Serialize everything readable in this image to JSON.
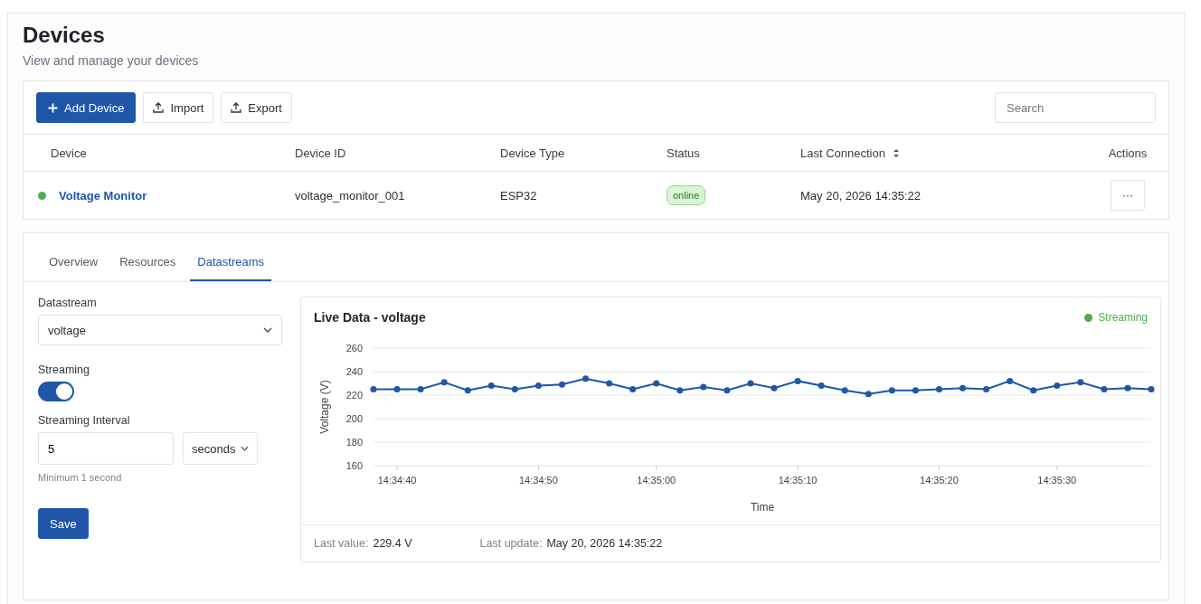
{
  "header": {
    "title": "Devices",
    "subtitle": "View and manage your devices"
  },
  "toolbar": {
    "buttons": [
      {
        "label": "Add Device",
        "kind": "primary"
      },
      {
        "label": "Import",
        "kind": "import"
      },
      {
        "label": "Export",
        "kind": "export"
      }
    ],
    "search": {
      "placeholder": "Search"
    }
  },
  "table": {
    "columns": [
      {
        "label": "Device",
        "sortable": false
      },
      {
        "label": "Device ID",
        "sortable": false
      },
      {
        "label": "Device Type",
        "sortable": false
      },
      {
        "label": "Status",
        "sortable": false
      },
      {
        "label": "Last Connection",
        "sortable": true
      },
      {
        "label": "Actions",
        "sortable": false
      }
    ],
    "rows": [
      {
        "device": "Voltage Monitor",
        "color": "#4caf50",
        "device_id": "voltage_monitor_001",
        "device_type": "ESP32",
        "status": "online",
        "last_connection": "May 20, 2026 14:35:22",
        "actions": "···"
      }
    ]
  },
  "tabs": [
    {
      "label": "Overview",
      "selected": false
    },
    {
      "label": "Resources",
      "selected": false
    },
    {
      "label": "Datastreams",
      "selected": true
    }
  ],
  "settings": {
    "datastream_label": "Datastream",
    "datastream": "voltage",
    "streaming_label": "Streaming",
    "streaming_on": true,
    "interval_label": "Streaming Interval",
    "interval": "5",
    "unit": "seconds",
    "hint": "Minimum 1 second",
    "save": "Save"
  },
  "live": {
    "title": "Live Data - voltage",
    "indicator": {
      "label": "Streaming",
      "color": "#4caf50"
    },
    "chart_data": {
      "type": "line",
      "xlabel": "Time",
      "ylabel": "Voltage (V)",
      "categories": [
        null,
        "14:34:40",
        null,
        null,
        null,
        null,
        null,
        "14:34:50",
        null,
        null,
        null,
        null,
        "14:35:00",
        null,
        null,
        null,
        null,
        null,
        "14:35:10",
        null,
        null,
        null,
        null,
        null,
        "14:35:20",
        null,
        null,
        null,
        null,
        "14:35:30",
        null,
        null,
        null,
        null
      ],
      "grid": true,
      "series": [
        {
          "marker": "circle",
          "color": "#1f56a8",
          "values": [
            225,
            225,
            225,
            231,
            224,
            228,
            225,
            228,
            229,
            234,
            230,
            225,
            230,
            224,
            227,
            224,
            230,
            226,
            232,
            228,
            224,
            221,
            224,
            224,
            225,
            226,
            225,
            232,
            224,
            228,
            231,
            225,
            226,
            225
          ]
        }
      ],
      "ylim": [
        160,
        260
      ],
      "yticks": [
        160,
        180,
        200,
        220,
        240,
        260
      ]
    },
    "last_value_label": "Last value:",
    "last_value": "229.4 V",
    "last_update_label": "Last update:",
    "last_update": "May 20, 2026 14:35:22"
  }
}
